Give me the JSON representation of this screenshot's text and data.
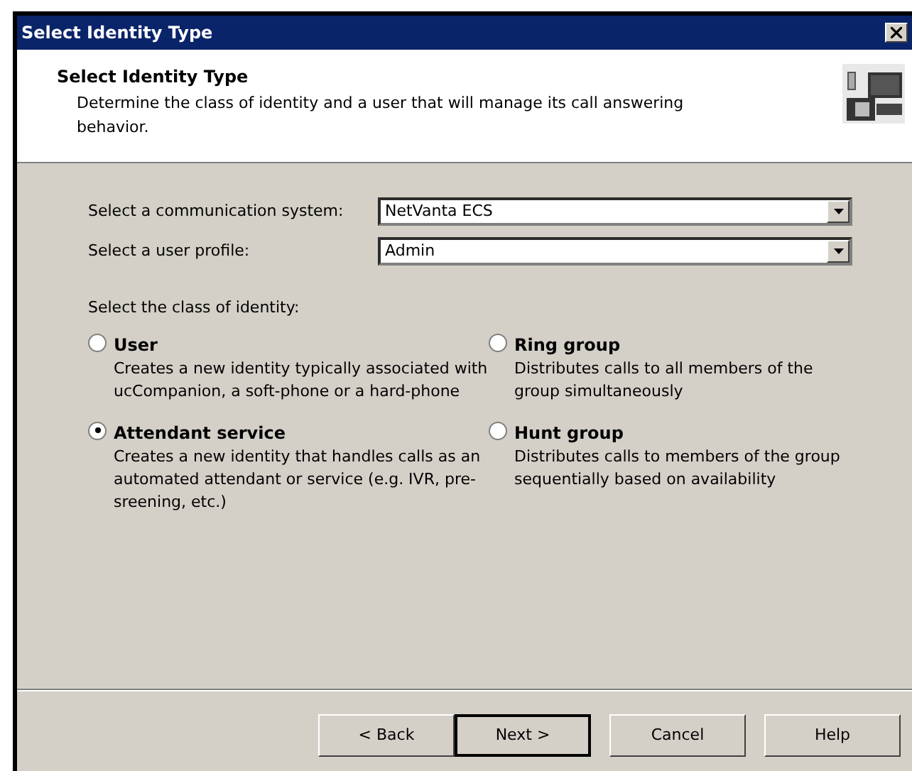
{
  "window": {
    "title": "Select Identity Type"
  },
  "header": {
    "title": "Select Identity Type",
    "description": "Determine the class of identity and a user that will manage its call answering behavior."
  },
  "fields": [
    {
      "label": "Select a communication system:",
      "value": "NetVanta ECS"
    },
    {
      "label": "Select a user profile:",
      "value": "Admin"
    }
  ],
  "identity_class": {
    "label": "Select the class of identity:",
    "options": [
      {
        "title": "User",
        "description": "Creates a new identity typically associated with ucCompanion, a soft-phone or a hard-phone",
        "selected": false
      },
      {
        "title": "Ring group",
        "description": "Distributes calls to all members of the group simultaneously",
        "selected": false
      },
      {
        "title": "Attendant service",
        "description": "Creates a new identity that handles calls as an automated attendant or service (e.g. IVR, pre-sreening, etc.)",
        "selected": true
      },
      {
        "title": "Hunt group",
        "description": "Distributes calls to members of the group sequentially based on availability",
        "selected": false
      }
    ]
  },
  "buttons": [
    {
      "label": "< Back",
      "default": false
    },
    {
      "label": "Next >",
      "default": true
    },
    {
      "label": "Cancel",
      "default": false
    },
    {
      "label": "Help",
      "default": false
    }
  ]
}
